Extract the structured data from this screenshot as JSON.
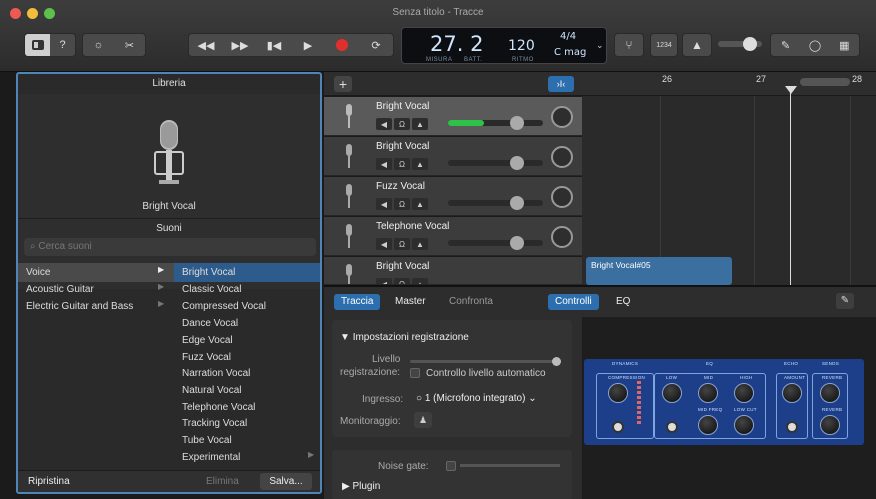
{
  "window": {
    "title": "Senza titolo - Tracce"
  },
  "toolbar": {
    "lcd": {
      "position": "27. 2",
      "position_label": "MISURA",
      "beat_label": "BATT.",
      "tempo": "120",
      "tempo_label": "RITMO",
      "time_signature": "4/4",
      "key": "C mag",
      "count_in": "1234"
    }
  },
  "library": {
    "header": "Libreria",
    "instrument_name": "Bright Vocal",
    "sounds_header": "Suoni",
    "search_placeholder": "Cerca suoni",
    "categories": [
      "Voice",
      "Acoustic Guitar",
      "Electric Guitar and Bass"
    ],
    "sounds": [
      "Bright Vocal",
      "Classic Vocal",
      "Compressed Vocal",
      "Dance Vocal",
      "Edge Vocal",
      "Fuzz Vocal",
      "Narration Vocal",
      "Natural Vocal",
      "Telephone Vocal",
      "Tracking Vocal",
      "Tube Vocal",
      "Experimental"
    ],
    "footer": {
      "reset": "Ripristina",
      "delete": "Elimina",
      "save": "Salva..."
    }
  },
  "tracks": [
    {
      "name": "Bright Vocal",
      "volume": 0.72,
      "selected": true,
      "meter": 0.38
    },
    {
      "name": "Bright Vocal",
      "volume": 0.72,
      "selected": false,
      "meter": 0
    },
    {
      "name": "Fuzz Vocal",
      "volume": 0.72,
      "selected": false,
      "meter": 0
    },
    {
      "name": "Telephone Vocal",
      "volume": 0.72,
      "selected": false,
      "meter": 0
    },
    {
      "name": "Bright Vocal",
      "volume": 0.72,
      "selected": false,
      "meter": 0
    }
  ],
  "timeline": {
    "bars": [
      "26",
      "27",
      "28"
    ],
    "region_name": "Bright Vocal#05"
  },
  "editor": {
    "tabs": [
      "Traccia",
      "Master",
      "Confronta"
    ],
    "right_tabs": [
      "Controlli",
      "EQ"
    ],
    "settings_header": "Impostazioni registrazione",
    "level_label_1": "Livello",
    "level_label_2": "registrazione:",
    "auto_level_label": "Controllo livello automatico",
    "input_label": "Ingresso:",
    "input_value": "1 (Microfono integrato)",
    "monitoring_label": "Monitoraggio:",
    "noise_gate_label": "Noise gate:",
    "plugin_label": "Plugin",
    "amp_sections": [
      "DYNAMICS",
      "EQ",
      "ECHO",
      "SENDS"
    ],
    "amp_labels": {
      "compression": "COMPRESSION",
      "low": "LOW",
      "mid": "MID",
      "high": "HIGH",
      "mid_freq": "MID FREQ",
      "low_cut": "LOW CUT",
      "echo_amount": "AMOUNT",
      "reverb1": "REVERB",
      "reverb2": "REVERB"
    }
  },
  "colors": {
    "accent": "#4f86b8",
    "selected_row": "#2d5c8c",
    "region": "#3b6fa0",
    "amp": "#1d3f8a"
  }
}
